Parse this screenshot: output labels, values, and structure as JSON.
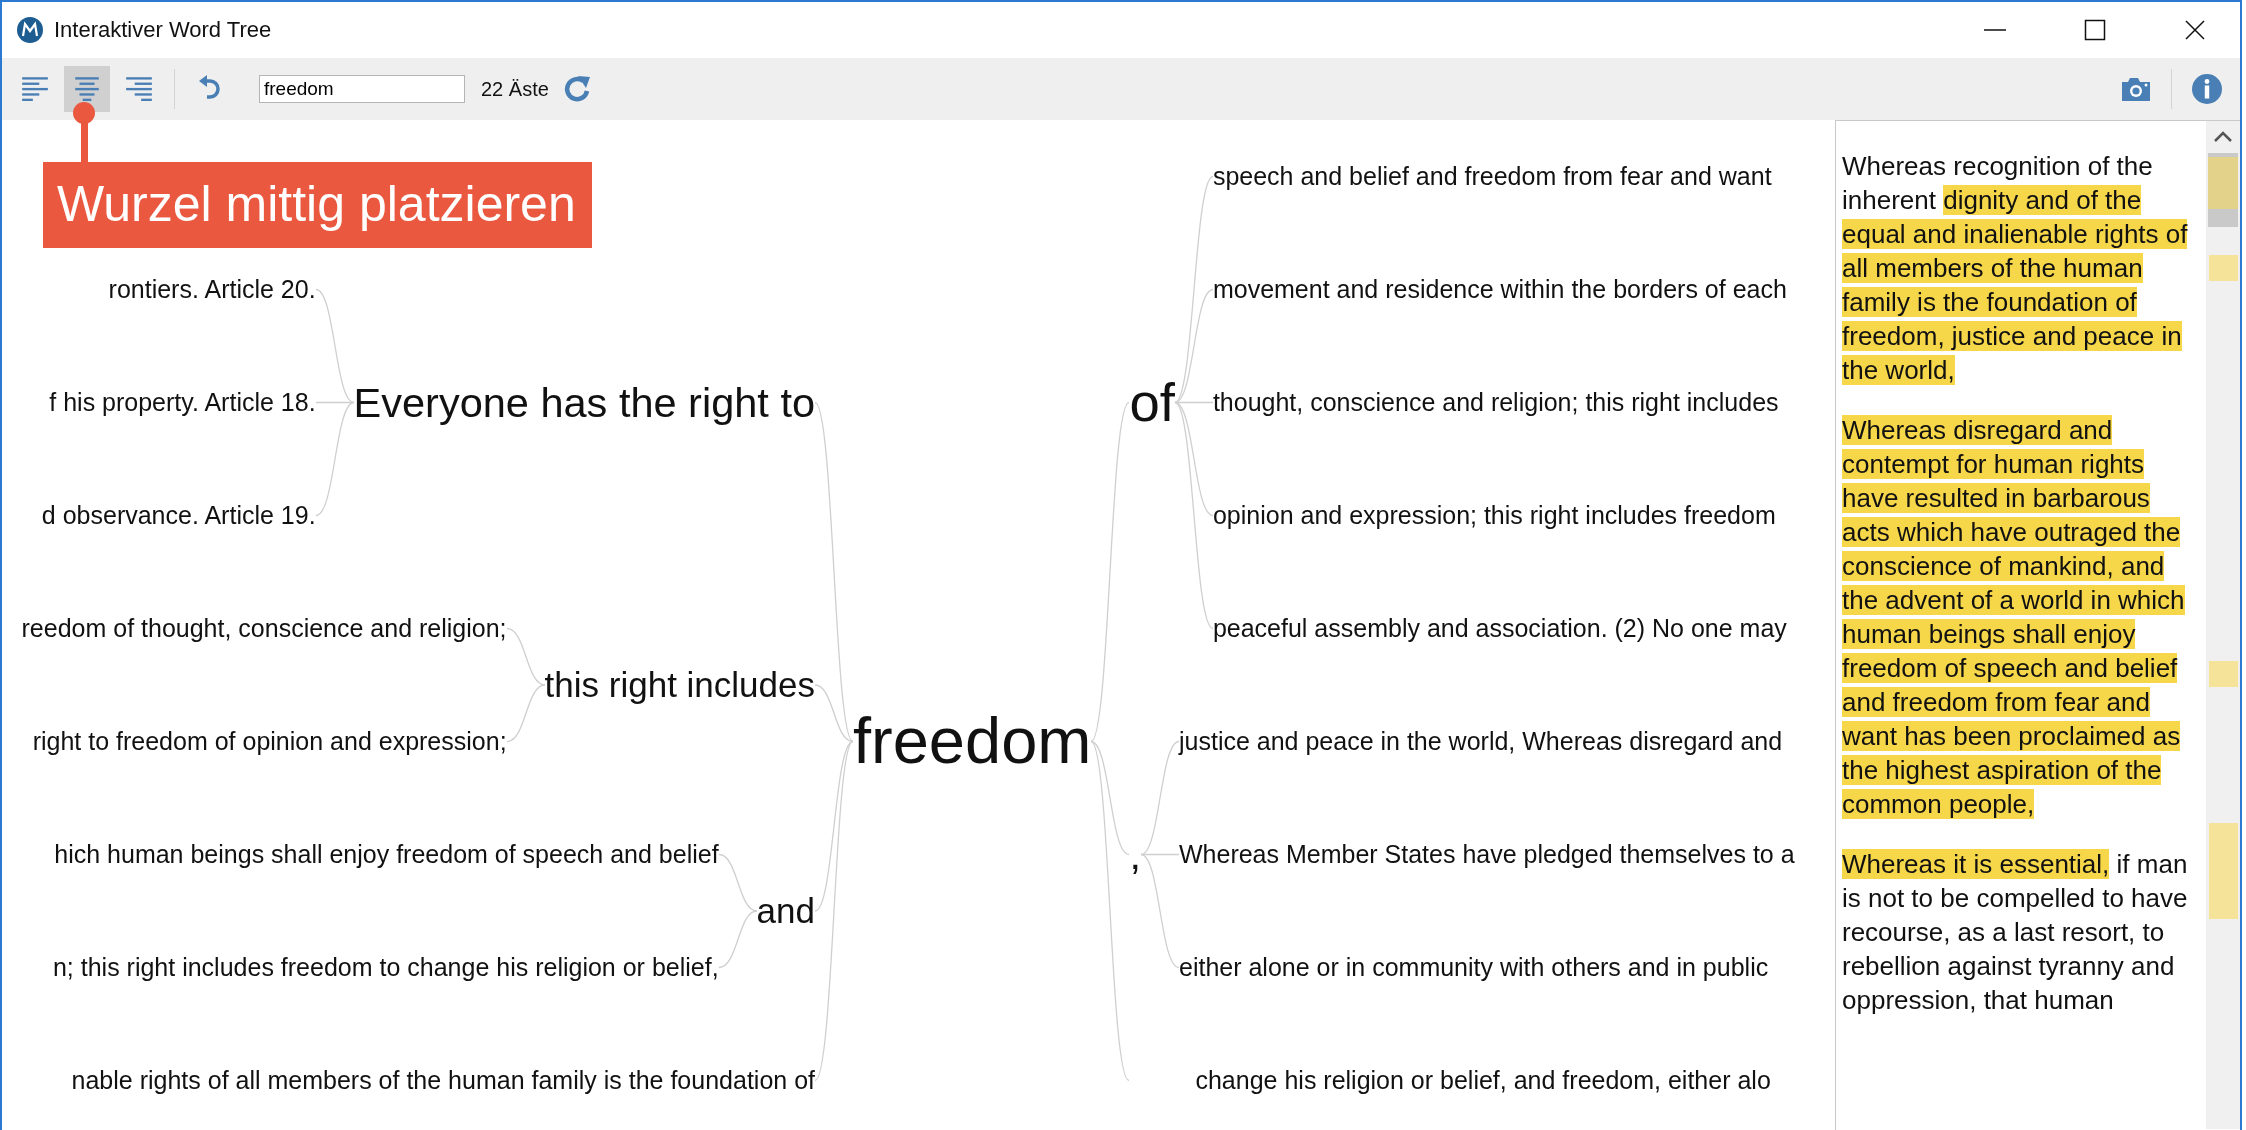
{
  "window": {
    "title": "Interaktiver Word Tree"
  },
  "toolbar": {
    "alignment": [
      {
        "kind": "left",
        "selected": false
      },
      {
        "kind": "center",
        "selected": true
      },
      {
        "kind": "right",
        "selected": false
      }
    ],
    "search": {
      "value": "freedom"
    },
    "branch_count": "22 Äste"
  },
  "callout": {
    "text": "Wurzel mittig platzieren"
  },
  "tree": {
    "root": "freedom",
    "left": [
      {
        "text": "Everyone has the right to",
        "children": [
          "rontiers. Article 20.",
          "f his property. Article 18.",
          "d observance. Article 19."
        ]
      },
      {
        "text": "this right includes",
        "children": [
          "reedom of thought, conscience and religion;",
          "right to freedom of opinion and expression;"
        ]
      },
      {
        "text": "and",
        "children": [
          "hich human beings shall enjoy freedom of speech and belief",
          "n; this right includes freedom to change his religion or belief,"
        ]
      },
      {
        "text": "nable rights of all members of the human family is the foundation of"
      }
    ],
    "right": [
      {
        "text": "of",
        "children": [
          "speech and belief and freedom from fear and want",
          "movement and residence within the borders of each",
          "thought, conscience and religion; this right includes",
          "opinion and expression; this right includes freedom",
          "peaceful assembly and association. (2) No one may"
        ]
      },
      {
        "text": ",",
        "children": [
          "justice and peace in the world, Whereas disregard and",
          "Whereas Member States have pledged themselves to a",
          "either alone or in community with others and in public"
        ]
      },
      {
        "text": "change his religion or belief, and freedom, either alo"
      }
    ]
  },
  "text_panel": {
    "paragraphs": [
      [
        {
          "text": "Whereas recognition of the inherent ",
          "highlighted": false
        },
        {
          "text": "dignity and of the equal and inalienable rights of all members of the human family is the foundation of freedom, justice and peace in the world,",
          "highlighted": true
        }
      ],
      [
        {
          "text": "Whereas disregard and contempt for human rights have resulted in barbarous acts which have outraged the conscience of mankind, and the advent of a world in which human beings shall enjoy freedom of speech and belief and freedom from fear and want has been proclaimed as the highest aspiration of the common people,",
          "highlighted": true
        }
      ],
      [
        {
          "text": "Whereas it is essential,",
          "highlighted": true
        },
        {
          "text": " if man is not to be compelled to have recourse, as a last resort, to rebellion against tyranny and oppression, that human",
          "highlighted": false
        }
      ]
    ]
  }
}
